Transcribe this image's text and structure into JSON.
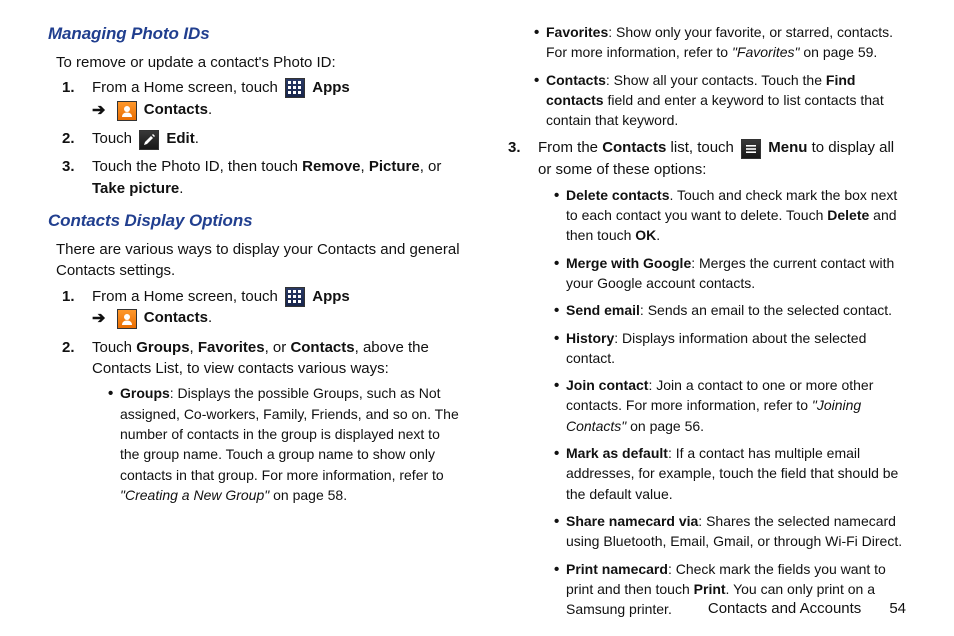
{
  "left": {
    "heading1": "Managing Photo IDs",
    "intro1": "To remove or update a contact's Photo ID:",
    "step1_a": "From a Home screen, touch ",
    "apps_label": "Apps",
    "contacts_label": "Contacts",
    "step2_a": "Touch ",
    "edit_label": "Edit",
    "step3_a": "Touch the Photo ID, then touch ",
    "remove": "Remove",
    "picture": "Picture",
    "take_picture": "Take picture",
    "heading2": "Contacts Display Options",
    "intro2": "There are various ways to display your Contacts and general Contacts settings.",
    "d_step1_a": "From a Home screen, touch ",
    "d_step2_a": "Touch ",
    "groups": "Groups",
    "favorites": "Favorites",
    "contacts": "Contacts",
    "d_step2_b": ", above the Contacts List, to view contacts various ways:",
    "b_groups": ": Displays the possible Groups, such as Not assigned, Co-workers, Family, Friends, and so on. The number of contacts in the group is displayed next to the group name. Touch a group name to show only contacts in that group. For more information, refer to ",
    "xref_groups": "\"Creating a New Group\"",
    "xref_groups_page": " on page 58."
  },
  "right": {
    "b_fav": ": Show only your favorite, or starred, contacts. For more information, refer to ",
    "xref_fav": "\"Favorites\"",
    "xref_fav_page": " on page 59.",
    "b_contacts": ": Show all your contacts. Touch the ",
    "find_contacts": "Find contacts",
    "b_contacts_b": " field and enter a keyword to list contacts that contain that keyword.",
    "step3_a": "From the ",
    "contacts_list": "Contacts",
    "step3_b": " list, touch ",
    "menu_label": "Menu",
    "step3_c": " to display all or some of these options:",
    "m_delete": "Delete contacts",
    "m_delete_b": ". Touch and check mark the box next to each contact you want to delete. Touch ",
    "delete": "Delete",
    "m_delete_c": " and then touch ",
    "ok": "OK",
    "m_merge": "Merge with Google",
    "m_merge_b": ": Merges the current contact with your Google account contacts.",
    "m_send": "Send email",
    "m_send_b": ": Sends an email to the selected contact.",
    "m_history": "History",
    "m_history_b": ": Displays information about the selected contact.",
    "m_join": "Join contact",
    "m_join_b": ": Join a contact to one or more other contacts. For more information, refer to ",
    "xref_join": "\"Joining Contacts\"",
    "xref_join_page": " on page 56.",
    "m_mark": "Mark as default",
    "m_mark_b": ": If a contact has multiple email addresses, for example, touch the field that should be the default value.",
    "m_share": "Share namecard via",
    "m_share_b": ": Shares the selected namecard using Bluetooth, Email, Gmail, or through Wi-Fi Direct.",
    "m_print": "Print namecard",
    "m_print_b": ": Check mark the fields you want to print and then touch ",
    "print": "Print",
    "m_print_c": ". You can only print on a Samsung printer."
  },
  "footer": {
    "section": "Contacts and Accounts",
    "page": "54"
  }
}
